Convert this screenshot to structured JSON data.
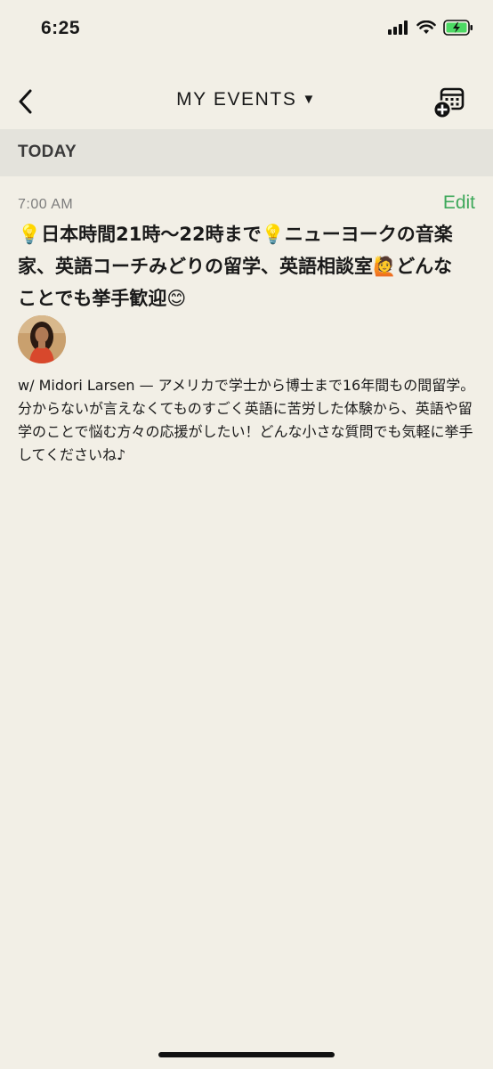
{
  "status_bar": {
    "time": "6:25"
  },
  "nav": {
    "title": "MY EVENTS",
    "caret": "▼"
  },
  "section": {
    "label": "TODAY"
  },
  "event": {
    "time": "7:00 AM",
    "edit_label": "Edit",
    "title": "💡日本時間21時〜22時まで💡ニューヨークの音楽家、英語コーチみどりの留学、英語相談室🙋どんなことでも挙手歓迎😊",
    "description": "w/ Midori Larsen — アメリカで学士から博士まで16年間もの間留学。分からないが言えなくてものすごく英語に苦労した体験から、英語や留学のことで悩む方々の応援がしたい！どんな小さな質問でも気軽に挙手してくださいね♪"
  },
  "colors": {
    "background": "#f2efe6",
    "section_header": "#e4e3dc",
    "accent_green": "#3ea85a",
    "time_gray": "#7d7d7d"
  },
  "icons": {
    "back": "chevron-left-icon",
    "calendar_add": "calendar-add-icon",
    "signal": "cellular-signal-icon",
    "wifi": "wifi-icon",
    "battery": "battery-charging-icon"
  }
}
